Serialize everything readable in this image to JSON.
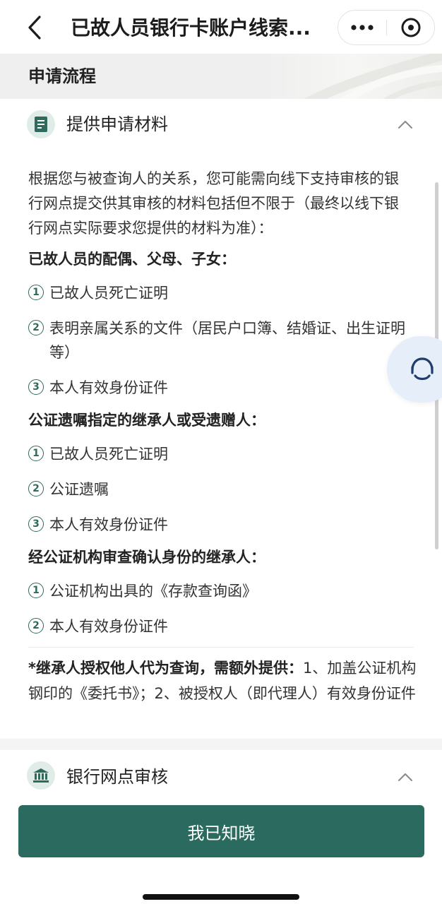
{
  "navbar": {
    "title": "已故人员银行卡账户线索...",
    "more_glyph": "•••"
  },
  "section_header": {
    "title": "申请流程"
  },
  "card1": {
    "title": "提供申请材料",
    "intro": "根据您与被查询人的关系，您可能需向线下支持审核的银行网点提交供其审核的材料包括但不限于（最终以线下银行网点实际要求您提供的材料为准）：",
    "groups": [
      {
        "heading": "已故人员的配偶、父母、子女：",
        "items": [
          {
            "num": "1",
            "text": "已故人员死亡证明"
          },
          {
            "num": "2",
            "text": "表明亲属关系的文件（居民户口簿、结婚证、出生证明等）"
          },
          {
            "num": "3",
            "text": "本人有效身份证件"
          }
        ]
      },
      {
        "heading": "公证遗嘱指定的继承人或受遗赠人：",
        "items": [
          {
            "num": "1",
            "text": "已故人员死亡证明"
          },
          {
            "num": "2",
            "text": "公证遗嘱"
          },
          {
            "num": "3",
            "text": "本人有效身份证件"
          }
        ]
      },
      {
        "heading": "经公证机构审查确认身份的继承人：",
        "items": [
          {
            "num": "1",
            "text": "公证机构出具的《存款查询函》"
          },
          {
            "num": "2",
            "text": "本人有效身份证件"
          }
        ]
      }
    ],
    "note_bold": "*继承人授权他人代为查询，需额外提供：",
    "note_rest": "1、加盖公证机构钢印的《委托书》；2、被授权人（即代理人）有效身份证件"
  },
  "card2": {
    "title": "银行网点审核"
  },
  "bottom": {
    "confirm_label": "我已知晓"
  },
  "colors": {
    "primary": "#2b6a5e",
    "icon_bg": "#dfece7",
    "service_bg": "#e6eefa"
  }
}
